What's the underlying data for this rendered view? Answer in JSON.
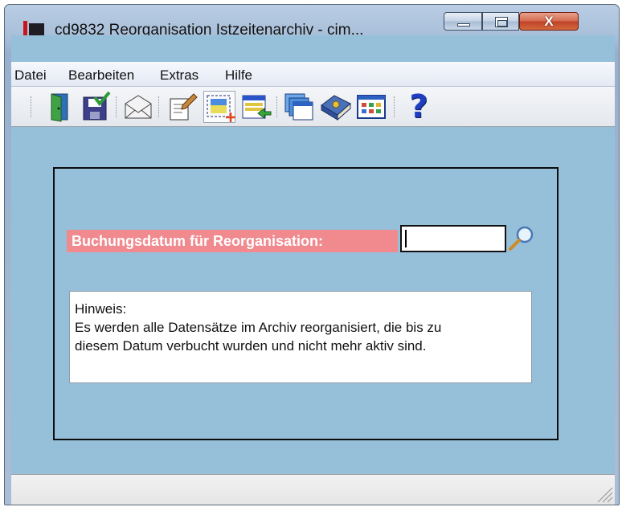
{
  "window": {
    "title": "cd9832 Reorganisation Istzeitenarchiv - cim...",
    "close_glyph": "X"
  },
  "menu": {
    "items": [
      "Datei",
      "Bearbeiten",
      "Extras",
      "Hilfe"
    ]
  },
  "toolbar": {
    "icons": [
      "exit-door-icon",
      "save-icon",
      "mail-icon",
      "edit-icon",
      "new-record-icon",
      "import-icon",
      "windows-icon",
      "book-icon",
      "grid-icon",
      "help-icon"
    ],
    "help_glyph": "?"
  },
  "form": {
    "date_label": "Buchungsdatum für Reorganisation:",
    "date_value": "",
    "hint_title": "Hinweis:",
    "hint_line1": "Es werden alle Datensätze im Archiv reorganisiert, die bis zu",
    "hint_line2": "diesem Datum verbucht wurden und nicht mehr aktiv sind."
  },
  "colors": {
    "client_bg": "#96bfda",
    "label_bg": "#f08a8f",
    "label_text": "#ffffff",
    "close_button": "#c0422a"
  }
}
